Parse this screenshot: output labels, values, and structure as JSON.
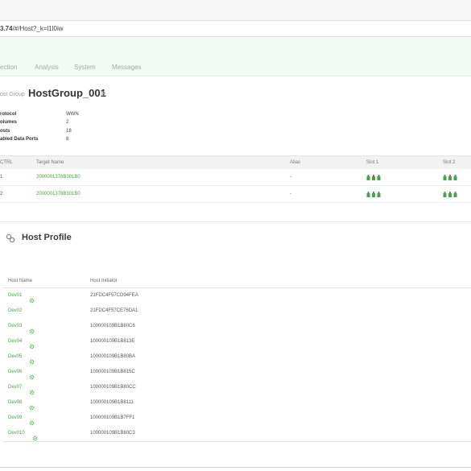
{
  "address_bar": {
    "host": "3.74",
    "path": "/#/Host?_k=l1l0iw"
  },
  "nav": {
    "items": [
      "ection",
      "Analysis",
      "System",
      "Messages"
    ]
  },
  "header": {
    "breadcrumb": "ost Group",
    "title": "HostGroup_001"
  },
  "properties": [
    {
      "key": "rotocol",
      "value": "WWN"
    },
    {
      "key": "olumes",
      "value": "2"
    },
    {
      "key": "osts",
      "value": "18"
    },
    {
      "key": "abled Data Ports",
      "value": "8"
    }
  ],
  "targets": {
    "columns": [
      "CTRL",
      "Target Name",
      "Alias",
      "Slot 1",
      "Slot 2"
    ],
    "rows": [
      {
        "ctrl": "1",
        "target_name": "2000001378B301B0",
        "alias": "-"
      },
      {
        "ctrl": "2",
        "target_name": "2000001378B301B0",
        "alias": "-"
      }
    ]
  },
  "host_profile": {
    "title": "Host Profile",
    "columns": [
      "Host Name",
      "Host Initiator"
    ],
    "rows": [
      {
        "name": "Dev01",
        "initiator": "21FDC4F57CD94FEA"
      },
      {
        "name": "Dev02",
        "initiator": "21FDC4F57CE76DA1"
      },
      {
        "name": "Dev03",
        "initiator": "100000109B1B80C6"
      },
      {
        "name": "Dev04",
        "initiator": "100000109B1B813E"
      },
      {
        "name": "Dev05",
        "initiator": "100000109B1B80BA"
      },
      {
        "name": "Dev06",
        "initiator": "100000109B1B815C"
      },
      {
        "name": "Dev07",
        "initiator": "100000109B1B80CC"
      },
      {
        "name": "Dev08",
        "initiator": "100000109B1B8111"
      },
      {
        "name": "Dev09",
        "initiator": "100000109B1B7FF1"
      },
      {
        "name": "Dev010",
        "initiator": "100000109B1B80C3"
      }
    ]
  },
  "icons": {
    "title_settings": "gear-icon",
    "host_settings": "gear-icon",
    "profile": "link-icon",
    "port": "port-status-icon"
  },
  "colors": {
    "accent": "#4aa34a",
    "nav_band": "#f3faf3"
  }
}
